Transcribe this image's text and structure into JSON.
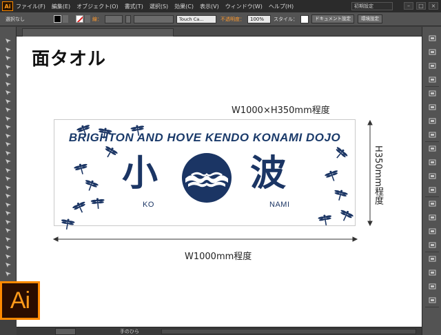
{
  "menubar": {
    "app_icon": "Ai",
    "items": [
      "ファイル(F)",
      "編集(E)",
      "オブジェクト(O)",
      "書式(T)",
      "選択(S)",
      "効果(C)",
      "表示(V)",
      "ウィンドウ(W)",
      "ヘルプ(H)"
    ],
    "workspace": "初期設定"
  },
  "controlbar": {
    "selection_label": "選択なし",
    "stroke_label": "線：",
    "brush_label": "Touch Ca...",
    "opacity_label": "不透明度：",
    "opacity_value": "100%",
    "style_label": "スタイル：",
    "doc_settings_button": "ドキュメント設定",
    "env_settings_button": "環境設定"
  },
  "canvas": {
    "page_title": "面タオル",
    "dim_top": "W1000×H350mm程度",
    "dim_bottom": "W1000mm程度",
    "dim_right": "H350mm程度"
  },
  "towel": {
    "heading": "BRIGHTON AND HOVE KENDO KONAMI DOJO",
    "kanji_left": "小",
    "kanji_right": "波",
    "romaji_left": "KO",
    "romaji_right": "NAMI",
    "ink_color": "#1b3564"
  },
  "bottombar": {
    "status_text": "手のひら"
  },
  "logo": {
    "text": "Ai",
    "accent": "#ff8a00"
  }
}
